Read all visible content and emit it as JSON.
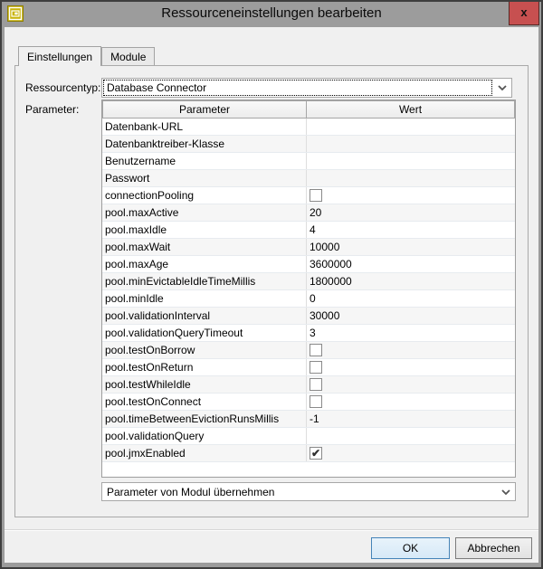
{
  "window": {
    "title": "Ressourceneinstellungen bearbeiten",
    "close_label": "x",
    "icon": "window-gold-icon"
  },
  "tabs": [
    {
      "label": "Einstellungen",
      "active": true
    },
    {
      "label": "Module",
      "active": false
    }
  ],
  "form": {
    "resource_type_label": "Ressourcentyp:",
    "resource_type_value": "Database Connector",
    "parameter_label": "Parameter:"
  },
  "table": {
    "headers": [
      "Parameter",
      "Wert"
    ],
    "rows": [
      {
        "name": "Datenbank-URL",
        "type": "text",
        "value": ""
      },
      {
        "name": "Datenbanktreiber-Klasse",
        "type": "text",
        "value": ""
      },
      {
        "name": "Benutzername",
        "type": "text",
        "value": ""
      },
      {
        "name": "Passwort",
        "type": "text",
        "value": ""
      },
      {
        "name": "connectionPooling",
        "type": "checkbox",
        "checked": false
      },
      {
        "name": "pool.maxActive",
        "type": "text",
        "value": "20"
      },
      {
        "name": "pool.maxIdle",
        "type": "text",
        "value": "4"
      },
      {
        "name": "pool.maxWait",
        "type": "text",
        "value": "10000"
      },
      {
        "name": "pool.maxAge",
        "type": "text",
        "value": "3600000"
      },
      {
        "name": "pool.minEvictableIdleTimeMillis",
        "type": "text",
        "value": "1800000"
      },
      {
        "name": "pool.minIdle",
        "type": "text",
        "value": "0"
      },
      {
        "name": "pool.validationInterval",
        "type": "text",
        "value": "30000"
      },
      {
        "name": "pool.validationQueryTimeout",
        "type": "text",
        "value": "3"
      },
      {
        "name": "pool.testOnBorrow",
        "type": "checkbox",
        "checked": false
      },
      {
        "name": "pool.testOnReturn",
        "type": "checkbox",
        "checked": false
      },
      {
        "name": "pool.testWhileIdle",
        "type": "checkbox",
        "checked": false
      },
      {
        "name": "pool.testOnConnect",
        "type": "checkbox",
        "checked": false
      },
      {
        "name": "pool.timeBetweenEvictionRunsMillis",
        "type": "text",
        "value": "-1"
      },
      {
        "name": "pool.validationQuery",
        "type": "text",
        "value": ""
      },
      {
        "name": "pool.jmxEnabled",
        "type": "checkbox",
        "checked": true
      }
    ],
    "checkmark_glyph": "✔"
  },
  "module_dropdown": {
    "value": "Parameter von Modul übernehmen"
  },
  "buttons": {
    "ok": "OK",
    "cancel": "Abbrechen"
  },
  "colors": {
    "titlebar": "#9c9c9c",
    "window_border": "#3e3e3e",
    "content_bg": "#f0f0f0",
    "close_button": "#c75050",
    "ok_button_border": "#4584b8",
    "ok_button_fill": "#dcebf7",
    "icon_gold": "#c9b40a"
  }
}
